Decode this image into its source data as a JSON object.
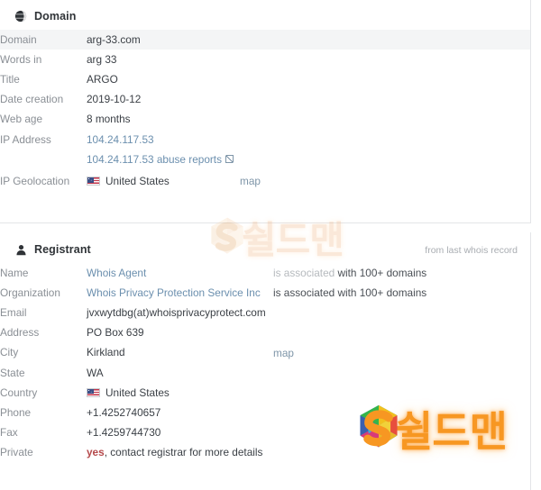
{
  "domain_card": {
    "icon": "globe-icon",
    "title": "Domain",
    "rows": [
      {
        "label": "Domain",
        "value": "arg-33.com",
        "striped": true
      },
      {
        "label": "Words in",
        "value": "arg 33"
      },
      {
        "label": "Title",
        "value": "ARGO"
      },
      {
        "label": "Date creation",
        "value": "2019-10-12"
      },
      {
        "label": "Web age",
        "value": "8 months"
      },
      {
        "label": "IP Address",
        "value": "104.24.117.53"
      },
      {
        "label": "",
        "value": "104.24.117.53 abuse reports",
        "ext_icon": "external-link-icon"
      },
      {
        "label": "IP Geolocation",
        "value": "United States",
        "flag": "us-flag-icon",
        "map": "map"
      }
    ]
  },
  "registrant_card": {
    "icon": "user-icon",
    "title": "Registrant",
    "note": "from last whois record",
    "rows": [
      {
        "label": "Name",
        "value": "Whois Agent",
        "assoc_prefix": "is associated",
        "assoc_suffix": " with 100+ domains",
        "assoc_dim": true
      },
      {
        "label": "Organization",
        "value": "Whois Privacy Protection Service Inc",
        "assoc_prefix": "is associated",
        "assoc_suffix": " with 100+ domains",
        "assoc_dim": false
      },
      {
        "label": "Email",
        "value": "jvxwytdbg(at)whoisprivacyprotect.com"
      },
      {
        "label": "Address",
        "value": "PO Box 639"
      },
      {
        "label": "City",
        "value": "Kirkland",
        "map": "map"
      },
      {
        "label": "State",
        "value": "WA"
      },
      {
        "label": "Country",
        "value": "United States",
        "flag": "us-flag-icon"
      },
      {
        "label": "Phone",
        "value": "+1.4252740657"
      },
      {
        "label": "Fax",
        "value": "+1.4259744730"
      },
      {
        "label": "Private",
        "value_strong": "yes",
        "value_rest": ", contact registrar for more details"
      }
    ]
  },
  "watermarks": {
    "top": {
      "text": "쉴드맨",
      "mark": "shieldman-s-logo"
    },
    "bottom": {
      "text": "쉴드맨",
      "mark": "shieldman-s-logo"
    }
  },
  "colors": {
    "link": "#6b8fae",
    "label": "#8a8f95",
    "value": "#3a3f45",
    "striped_row": "#f4f5f6",
    "border": "#e3e5e8",
    "private_yes": "#b5494b",
    "watermark_orange": "#f79722"
  }
}
